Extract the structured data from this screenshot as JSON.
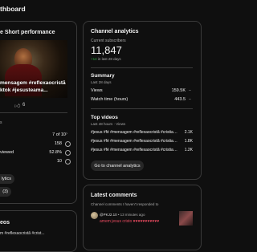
{
  "header": {
    "title": "thboard"
  },
  "short_card": {
    "title": "e Short performance",
    "caption_line1": "mensagem #reflexaocristã",
    "caption_line2": "ktok #jesusteama...",
    "likes": "6",
    "rank_label": "",
    "rank_value": "7 of 10",
    "views_label": "s",
    "views_value": "158",
    "viewed_label": "viewed",
    "viewed_value": "52.8%",
    "subs_value": "10",
    "analytics_button": "lytics",
    "comments_button": "(3)"
  },
  "channel": {
    "title": "Channel analytics",
    "subs_label": "Current subscribers",
    "subs_value": "11,847",
    "subs_change": "+14",
    "subs_change_suffix": " in last 28 days",
    "summary_title": "Summary",
    "summary_sub": "Last 28 days",
    "metrics": [
      {
        "label": "Views",
        "value": "159.5K"
      },
      {
        "label": "Watch time (hours)",
        "value": "443.5"
      }
    ],
    "top_title": "Top videos",
    "top_sub": "Last 48 hours · Views",
    "videos": [
      {
        "title": "#jesus #fé #mensagem #reflexaocristã #cristianismo...",
        "value": "2.1K"
      },
      {
        "title": "#jesus #fé #mensagem #reflexaocristã #cristianismo...",
        "value": "1.8K"
      },
      {
        "title": "#jesus #fé #mensagem #reflexaocristã #cristianismo...",
        "value": "1.2K"
      }
    ],
    "go_button": "Go to channel analytics"
  },
  "comments": {
    "title": "Latest comments",
    "sub": "Channel comments I haven't responded to",
    "author": "@PKJ2.10",
    "time": " • 13 minutes ago",
    "text": "amem jesus cristo ♥♥♥♥♥♥♥♥♥♥♥"
  },
  "bottom_left": {
    "title": "eos",
    "line": "m #reflexaocristã #crist..."
  },
  "colors": {
    "accent_green": "#2ba640",
    "bg": "#0f0f0f",
    "border": "#3a3a3a"
  }
}
